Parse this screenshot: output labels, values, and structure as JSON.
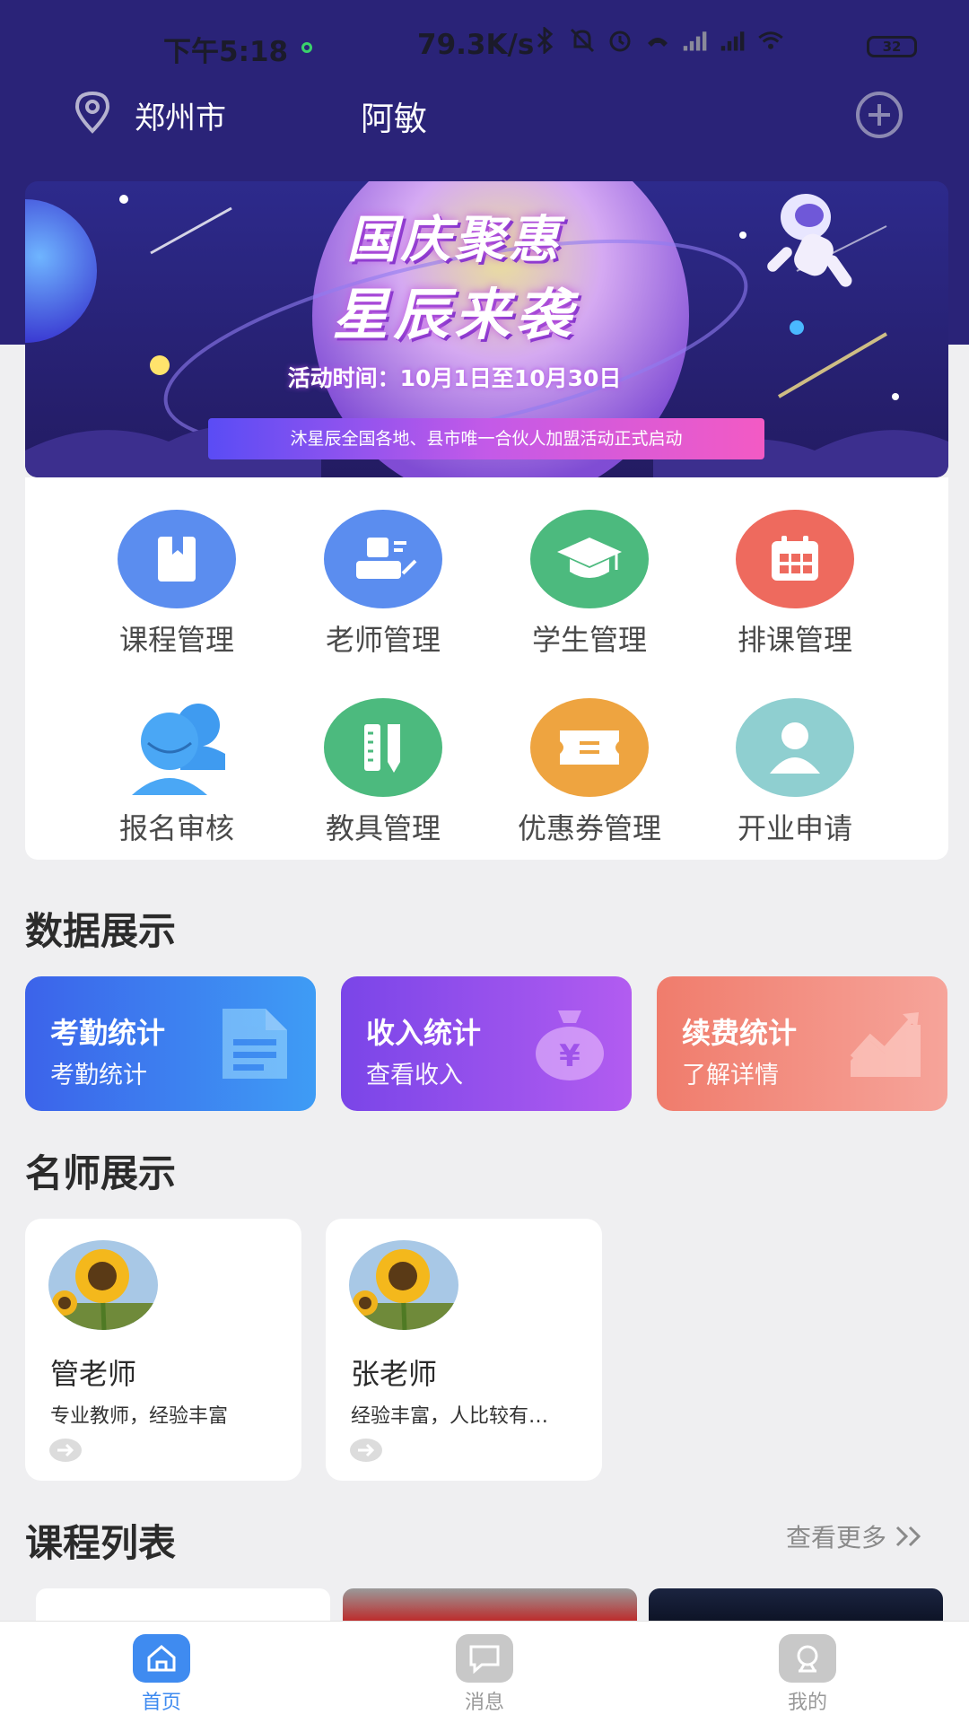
{
  "status_bar": {
    "time": "下午5:18",
    "net_speed": "79.3K/s",
    "battery": "32"
  },
  "header": {
    "city": "郑州市",
    "username": "阿敏"
  },
  "banner": {
    "title_line1": "国庆聚惠",
    "title_line2": "星辰来袭",
    "date_text": "活动时间：10月1日至10月30日",
    "strip_text": "沐星辰全国各地、县市唯一合伙人加盟活动正式启动"
  },
  "grid": [
    {
      "label": "课程管理",
      "icon": "book-icon",
      "color": "#5b8def"
    },
    {
      "label": "老师管理",
      "icon": "teacher-icon",
      "color": "#5b8def"
    },
    {
      "label": "学生管理",
      "icon": "graduation-cap-icon",
      "color": "#4cba7e"
    },
    {
      "label": "排课管理",
      "icon": "calendar-icon",
      "color": "#ee6a5e"
    },
    {
      "label": "报名审核",
      "icon": "users-icon",
      "color": "#3f9bf0"
    },
    {
      "label": "教具管理",
      "icon": "ruler-pencil-icon",
      "color": "#4cba7e"
    },
    {
      "label": "优惠券管理",
      "icon": "ticket-icon",
      "color": "#eea440"
    },
    {
      "label": "开业申请",
      "icon": "person-icon",
      "color": "#8fcfd0"
    }
  ],
  "sections": {
    "data_display": "数据展示",
    "teacher_display": "名师展示",
    "course_list": "课程列表",
    "see_more": "查看更多"
  },
  "stats": [
    {
      "title": "考勤统计",
      "sub": "考勤统计",
      "icon": "document-icon"
    },
    {
      "title": "收入统计",
      "sub": "查看收入",
      "icon": "money-bag-icon"
    },
    {
      "title": "续费统计",
      "sub": "了解详情",
      "icon": "trend-chart-icon"
    }
  ],
  "teachers": [
    {
      "name": "管老师",
      "desc": "专业教师，经验丰富"
    },
    {
      "name": "张老师",
      "desc": "经验丰富，人比较有…"
    }
  ],
  "tabs": [
    {
      "label": "首页",
      "icon": "home-icon",
      "active": true
    },
    {
      "label": "消息",
      "icon": "message-icon",
      "active": false
    },
    {
      "label": "我的",
      "icon": "profile-icon",
      "active": false
    }
  ],
  "colors": {
    "header_bg": "#2a2378",
    "tab_active": "#3f8bf0",
    "tab_inactive": "#999999"
  }
}
